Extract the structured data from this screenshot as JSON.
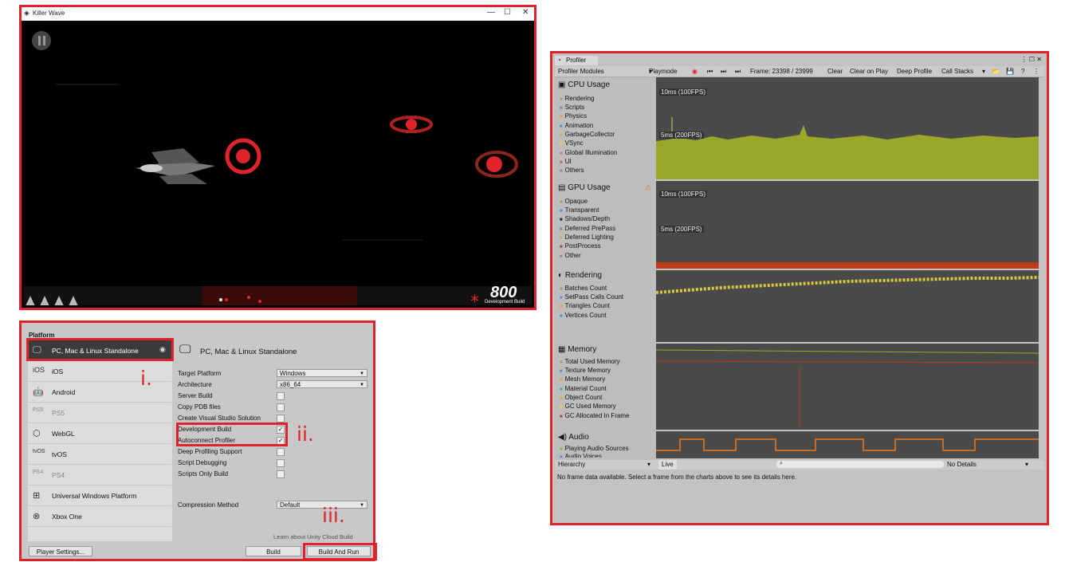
{
  "game_window": {
    "title": "Killer Wave",
    "minimize": "—",
    "maximize": "☐",
    "close": "✕",
    "score": "800",
    "build_label": "Development Build"
  },
  "build_settings": {
    "platform_heading": "Platform",
    "platforms": [
      {
        "label": "PC, Mac & Linux Standalone",
        "icon": "monitor-icon"
      },
      {
        "label": "iOS",
        "icon": "ios-icon"
      },
      {
        "label": "Android",
        "icon": "android-icon"
      },
      {
        "label": "PS5",
        "icon": "ps5-icon"
      },
      {
        "label": "WebGL",
        "icon": "html5-icon"
      },
      {
        "label": "tvOS",
        "icon": "tvos-icon"
      },
      {
        "label": "PS4",
        "icon": "ps4-icon"
      },
      {
        "label": "Universal Windows Platform",
        "icon": "windows-icon"
      },
      {
        "label": "Xbox One",
        "icon": "xbox-icon"
      }
    ],
    "selected_title": "PC, Mac & Linux Standalone",
    "target_platform_label": "Target Platform",
    "target_platform_value": "Windows",
    "architecture_label": "Architecture",
    "architecture_value": "x86_64",
    "options": [
      {
        "label": "Server Build",
        "checked": ""
      },
      {
        "label": "Copy PDB files",
        "checked": ""
      },
      {
        "label": "Create Visual Studio Solution",
        "checked": ""
      },
      {
        "label": "Development Build",
        "checked": "✓"
      },
      {
        "label": "Autoconnect Profiler",
        "checked": "✓"
      },
      {
        "label": "Deep Profiling Support",
        "checked": ""
      },
      {
        "label": "Script Debugging",
        "checked": ""
      },
      {
        "label": "Scripts Only Build",
        "checked": ""
      }
    ],
    "compression_label": "Compression Method",
    "compression_value": "Default",
    "cloud_link": "Learn about Unity Cloud Build",
    "player_settings": "Player Settings...",
    "build": "Build",
    "build_and_run": "Build And Run"
  },
  "annotations": {
    "i": "i.",
    "ii": "ii.",
    "iii": "iii."
  },
  "profiler": {
    "tab": "Profiler",
    "modules": "Profiler Modules",
    "playmode": "Playmode",
    "frame": "Frame: 23398 / 23999",
    "clear": "Clear",
    "clear_on_play": "Clear on Play",
    "deep_profile": "Deep Profile",
    "call_stacks": "Call Stacks",
    "sections": [
      {
        "title": "CPU Usage",
        "items": [
          "Rendering",
          "Scripts",
          "Physics",
          "Animation",
          "GarbageCollector",
          "VSync",
          "Global Illumination",
          "UI",
          "Others"
        ],
        "colors": [
          "#7cb342",
          "#4a8dd8",
          "#e6a23c",
          "#3c9fb8",
          "#c8b830",
          "#e8d040",
          "#cc7090",
          "#a07050",
          "#8a8a8a"
        ]
      },
      {
        "title": "GPU Usage",
        "items": [
          "Opaque",
          "Transparent",
          "Shadows/Depth",
          "Deferred PrePass",
          "Deferred Lighting",
          "PostProcess",
          "Other"
        ],
        "colors": [
          "#7cb342",
          "#4a8dd8",
          "#222222",
          "#3c9fb8",
          "#c8b830",
          "#c03030",
          "#8a8a8a"
        ]
      },
      {
        "title": "Rendering",
        "items": [
          "Batches Count",
          "SetPass Calls Count",
          "Triangles Count",
          "Vertices Count"
        ],
        "colors": [
          "#7cb342",
          "#4a8dd8",
          "#e6a23c",
          "#3c9fb8"
        ]
      },
      {
        "title": "Memory",
        "items": [
          "Total Used Memory",
          "Texture Memory",
          "Mesh Memory",
          "Material Count",
          "Object Count",
          "GC Used Memory",
          "GC Allocated In Frame"
        ],
        "colors": [
          "#7cb342",
          "#4a8dd8",
          "#e6a23c",
          "#3c9fb8",
          "#c8b830",
          "#e8d040",
          "#c03030"
        ]
      },
      {
        "title": "Audio",
        "items": [
          "Playing Audio Sources",
          "Audio Voices"
        ],
        "colors": [
          "#7cb342",
          "#4a8dd8"
        ]
      }
    ],
    "cpu_10ms": "10ms (100FPS)",
    "cpu_5ms": "5ms (200FPS)",
    "gpu_10ms": "10ms (100FPS)",
    "gpu_5ms": "5ms (200FPS)",
    "hierarchy": "Hierarchy",
    "live": "Live",
    "no_details": "No Details",
    "no_frame": "No frame data available. Select a frame from the charts above to see its details here."
  },
  "colors": {
    "frame_red": "#e0232b",
    "cpu_fill": "#9aa82a",
    "gpu_line": "#c0391b"
  }
}
